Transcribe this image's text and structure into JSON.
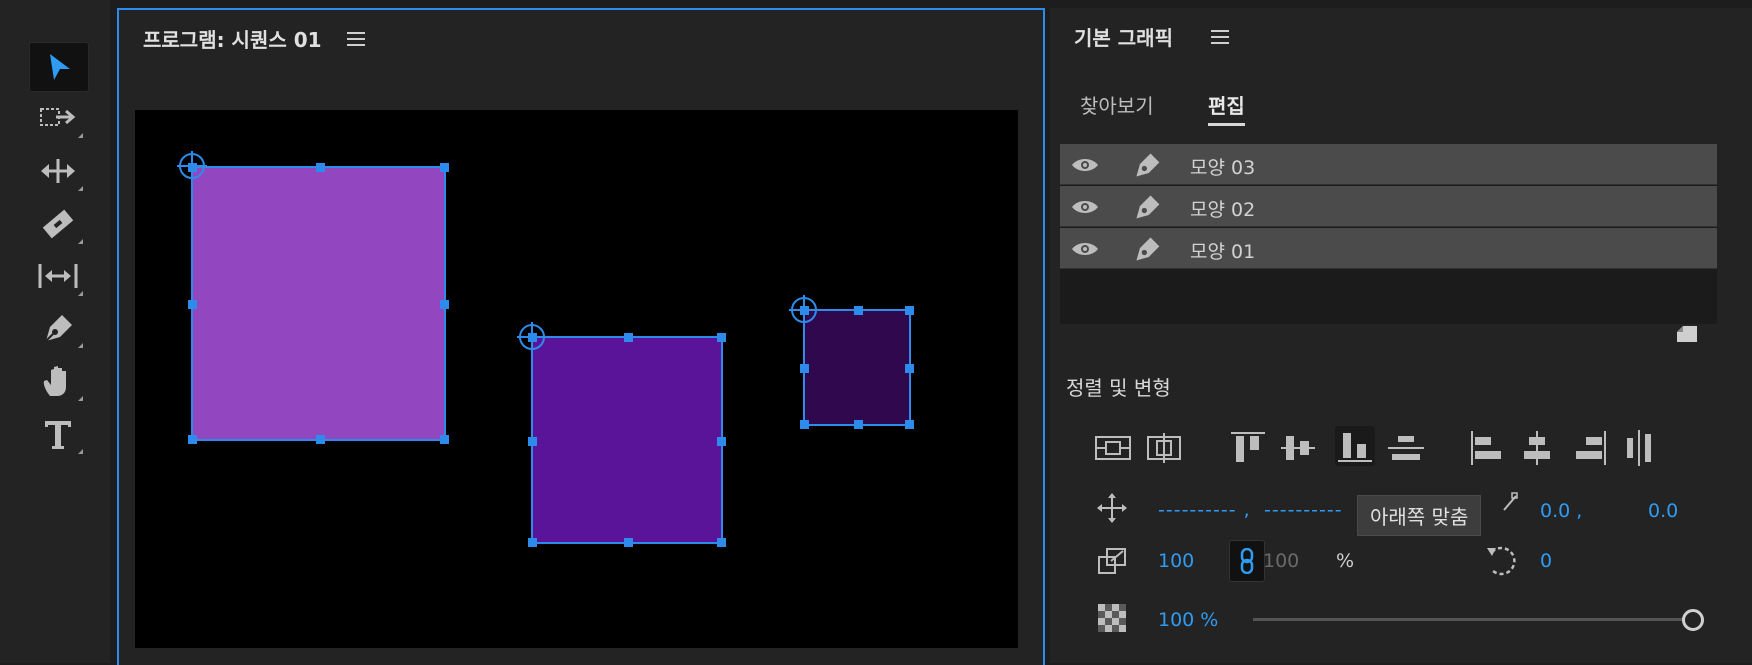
{
  "program_panel": {
    "title": "프로그램: 시퀀스 01"
  },
  "graphics_panel": {
    "title": "기본 그래픽",
    "tabs": [
      {
        "label": "찾아보기"
      },
      {
        "label": "편집"
      }
    ],
    "layers": [
      {
        "label": "모양 03"
      },
      {
        "label": "모양 02"
      },
      {
        "label": "모양 01"
      }
    ],
    "section_title": "정렬 및 변형",
    "position": {
      "x_placeholder": "---------- ,",
      "y_placeholder": "----------"
    },
    "anchor": {
      "x": "0.0 ,",
      "y": "0.0"
    },
    "scale": {
      "width": "100",
      "height": "100",
      "unit": "%"
    },
    "rotation": "0",
    "opacity": "100 %",
    "opacity_level": 1.0,
    "tooltip": "아래쪽 맞춤"
  },
  "shapes": [
    {
      "name": "모양 01",
      "color": "#9246c0"
    },
    {
      "name": "모양 02",
      "color": "#5a149a"
    },
    {
      "name": "모양 03",
      "color": "#30084e"
    }
  ],
  "colors": {
    "accent": "#2d8ceb",
    "value_text": "#2f9bf2"
  }
}
